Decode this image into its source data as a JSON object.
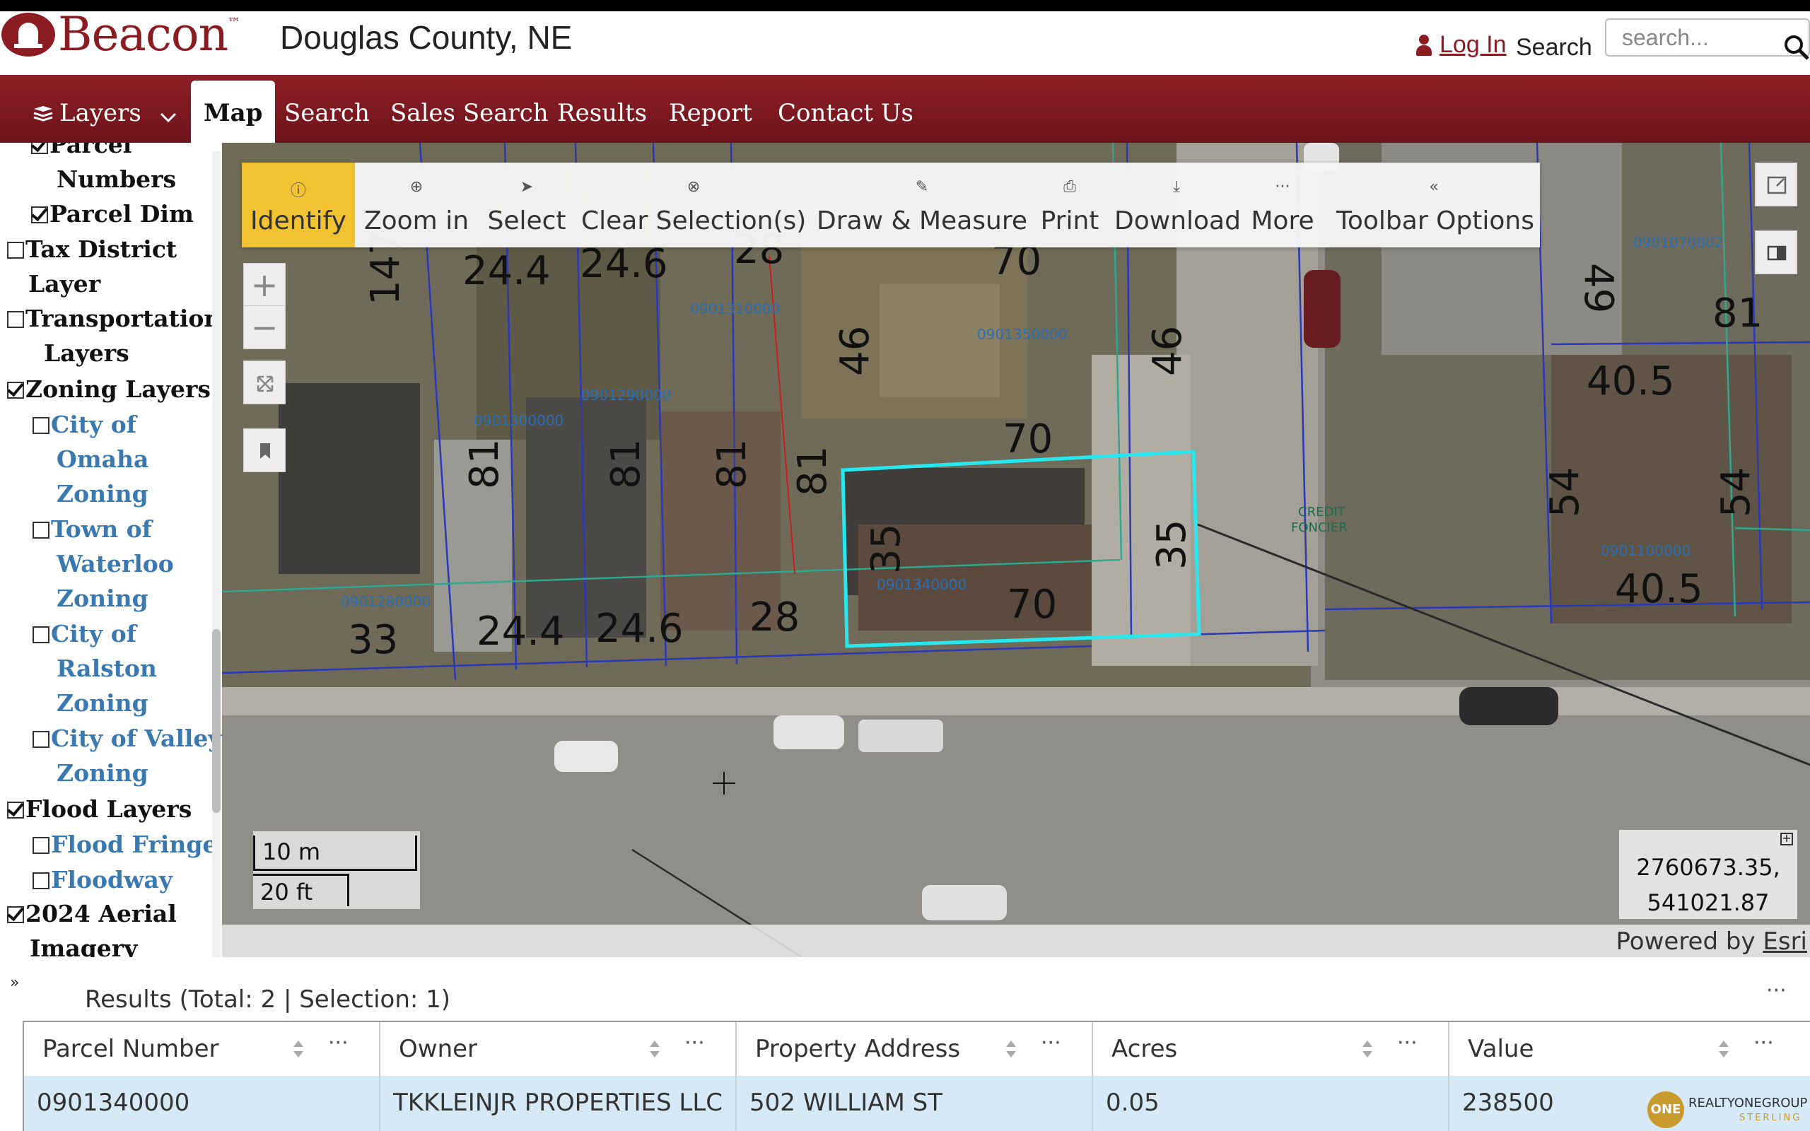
{
  "header": {
    "brand": "Beacon",
    "brand_tm": "™",
    "county": "Douglas County, NE",
    "login": "Log In",
    "search_label": "Search",
    "search_placeholder": "search..."
  },
  "nav": {
    "layers": "Layers",
    "items": [
      "Map",
      "Search",
      "Sales Search",
      "Results",
      "Report",
      "Contact Us"
    ]
  },
  "sidebar": {
    "rows": [
      {
        "line1": "Parcel",
        "line2": "Numbers",
        "checked": true
      },
      {
        "label": "Parcel Dim",
        "checked": true
      },
      {
        "line1": "Tax District",
        "line2": "Layer",
        "checked": false
      },
      {
        "line1": "Transportation",
        "line2": "Layers",
        "checked": false
      },
      {
        "label": "Zoning Layers",
        "checked": true
      },
      {
        "line1": "City of",
        "line2": "Omaha",
        "line3": "Zoning",
        "checked": false
      },
      {
        "line1": "Town of",
        "line2": "Waterloo",
        "line3": "Zoning",
        "checked": false
      },
      {
        "line1": "City of",
        "line2": "Ralston",
        "line3": "Zoning",
        "checked": false
      },
      {
        "line1": "City of Valley",
        "line2": "Zoning",
        "checked": false
      },
      {
        "label": "Flood Layers",
        "checked": true
      },
      {
        "label": "Flood Fringe",
        "checked": false
      },
      {
        "label": "Floodway",
        "checked": false
      },
      {
        "line1": "2024 Aerial",
        "line2": "Imagery",
        "checked": true
      }
    ]
  },
  "toolbar": {
    "items": [
      "Identify",
      "Zoom in",
      "Select",
      "Clear Selection(s)",
      "Draw & Measure",
      "Print",
      "Download",
      "More",
      "Toolbar Options"
    ],
    "active": "Identify"
  },
  "map": {
    "scale_metric": "10 m",
    "scale_imperial": "20 ft",
    "coord_x": "2760673.35,",
    "coord_y": "541021.87",
    "attribution_prefix": "Powered by ",
    "attribution_link": "Esri",
    "parcel_ids": [
      "0901310000",
      "0901350000",
      "0901300000",
      "0901290000",
      "0901340000",
      "0901280000",
      "0901070002",
      "0901100000"
    ],
    "dims": [
      "147",
      "24.4",
      "24.6",
      "28",
      "70",
      "46",
      "46",
      "70",
      "81",
      "81",
      "81",
      "81",
      "35",
      "35",
      "70",
      "24.4",
      "24.6",
      "28",
      "33",
      "49",
      "81",
      "40.5",
      "54",
      "54",
      "40.5"
    ],
    "label_credit": "CREDIT",
    "label_foncier": "FONCIER"
  },
  "results": {
    "title": "Results (Total: 2 | Selection: 1)",
    "columns": [
      "Parcel Number",
      "Owner",
      "Property Address",
      "Acres",
      "Value"
    ],
    "rows": [
      [
        "0901340000",
        "TKKLEINJR PROPERTIES LLC",
        "502 WILLIAM ST",
        "0.05",
        "238500"
      ]
    ]
  },
  "watermark": {
    "badge": "ONE",
    "name": "REALTYONEGROUP",
    "sub": "STERLING"
  }
}
